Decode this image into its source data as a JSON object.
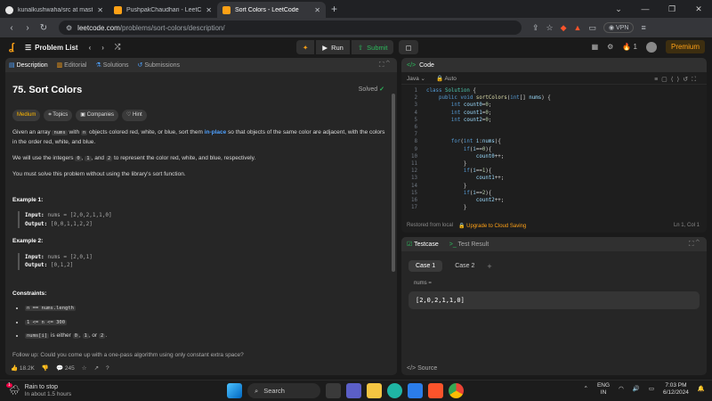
{
  "browser": {
    "tabs": [
      {
        "title": "kunalkushwaha/src at master · Pusho",
        "active": false,
        "color": "#e6e6e6"
      },
      {
        "title": "PushpakChaudhari - LeetCode Profil",
        "active": false,
        "color": "#ffa116"
      },
      {
        "title": "Sort Colors - LeetCode",
        "active": true,
        "color": "#ffa116"
      }
    ],
    "url_host": "leetcode.com",
    "url_path": "/problems/sort-colors/description/",
    "vpn_label": "VPN"
  },
  "lc_bar": {
    "problem_list": "Problem List",
    "run": "Run",
    "submit": "Submit",
    "streak": "1",
    "premium": "Premium"
  },
  "left_tabs": [
    "Description",
    "Editorial",
    "Solutions",
    "Submissions"
  ],
  "problem": {
    "title": "75. Sort Colors",
    "status": "Solved",
    "tags": [
      "Medium",
      "Topics",
      "Companies",
      "Hint"
    ],
    "p1_a": "Given an array ",
    "p1_code1": "nums",
    "p1_b": " with ",
    "p1_code2": "n",
    "p1_c": " objects colored red, white, or blue, sort them ",
    "p1_link": "in-place",
    "p1_d": " so that objects of the same color are adjacent, with the colors in the order red, white, and blue.",
    "p2_a": "We will use the integers ",
    "p2_c0": "0",
    "p2_s1": ", ",
    "p2_c1": "1",
    "p2_s2": ", and ",
    "p2_c2": "2",
    "p2_b": " to represent the color red, white, and blue, respectively.",
    "p3": "You must solve this problem without using the library's sort function.",
    "examples": [
      {
        "title": "Example 1:",
        "input": "nums = [2,0,2,1,1,0]",
        "output": "[0,0,1,1,2,2]"
      },
      {
        "title": "Example 2:",
        "input": "nums = [2,0,1]",
        "output": "[0,1,2]"
      }
    ],
    "input_label": "Input:",
    "output_label": "Output:",
    "constraints_title": "Constraints:",
    "constraints": {
      "c1": "n == nums.length",
      "c2": "1 <= n <= 300",
      "c3_code": "nums[i]",
      "c3_a": " is either ",
      "c3_c0": "0",
      "c3_s": ", ",
      "c3_c1": "1",
      "c3_or": ", or ",
      "c3_c2": "2",
      "c3_end": "."
    },
    "followup": "Follow up: Could you come up with a one-pass algorithm using only constant extra space?"
  },
  "left_footer": {
    "likes": "18.2K",
    "comments": "245"
  },
  "code": {
    "header": "Code",
    "language": "Java",
    "mode": "Auto",
    "lines": [
      "1",
      "2",
      "3",
      "4",
      "5",
      "6",
      "7",
      "8",
      "9",
      "10",
      "11",
      "12",
      "13",
      "14",
      "15",
      "16",
      "17"
    ],
    "restored": "Restored from local",
    "upgrade": "Upgrade to Cloud Saving",
    "cursor": "Ln 1, Col 1"
  },
  "testcase": {
    "tab1": "Testcase",
    "tab2": "Test Result",
    "case1": "Case 1",
    "case2": "Case 2",
    "label": "nums =",
    "value": "[2,0,2,1,1,0]",
    "source": "Source"
  },
  "taskbar": {
    "weather_title": "Rain to stop",
    "weather_sub": "In about 1.5 hours",
    "weather_badge": "1",
    "search": "Search",
    "lang1": "ENG",
    "lang2": "IN",
    "time": "7:03 PM",
    "date": "6/12/2024"
  }
}
